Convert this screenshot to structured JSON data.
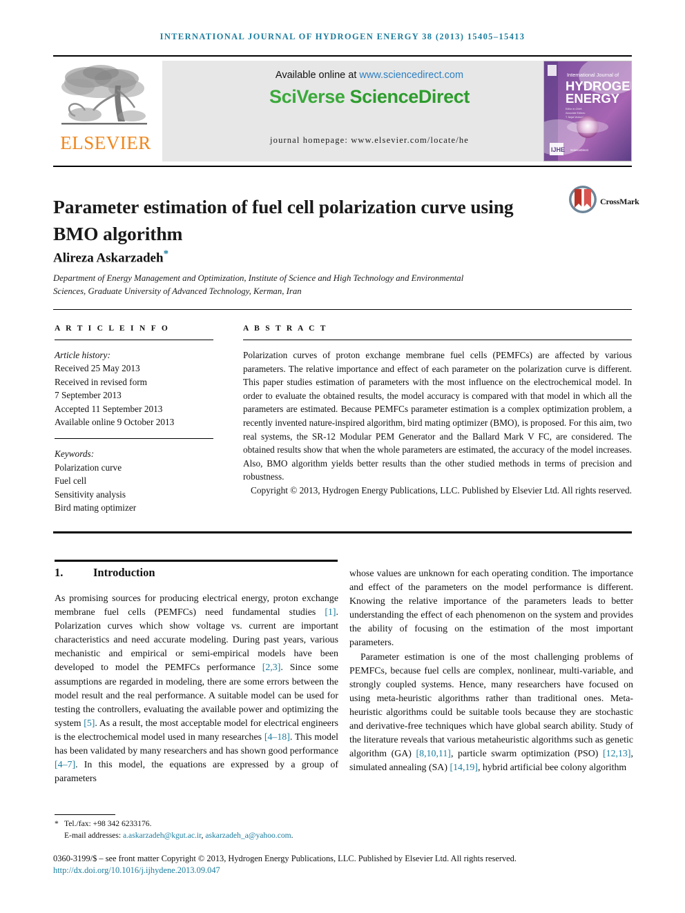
{
  "running_head": "International Journal of Hydrogen Energy 38 (2013) 15405–15413",
  "masthead": {
    "publisher_name": "ELSEVIER",
    "available_prefix": "Available online at ",
    "available_url": "www.sciencedirect.com",
    "platform_part1": "SciVerse ",
    "platform_part2": "ScienceDirect",
    "homepage": "journal homepage: www.elsevier.com/locate/he",
    "cover": {
      "line1": "International Journal of",
      "line2": "HYDROGEN",
      "line3": "ENERGY",
      "editor_label_1": "Editor-in-Chief:",
      "editor_label_2": "Associate Editors:",
      "footer_mark": "IJHE",
      "footer_text": "Available online at ScienceDirect"
    }
  },
  "article": {
    "title": "Parameter estimation of fuel cell polarization curve using BMO algorithm",
    "crossmark_label": "CrossMark",
    "author": "Alireza Askarzadeh",
    "author_marker": "*",
    "affiliation": "Department of Energy Management and Optimization, Institute of Science and High Technology and Environmental Sciences, Graduate University of Advanced Technology, Kerman, Iran"
  },
  "article_info": {
    "heading": "A R T I C L E  I N F O",
    "history_label": "Article history:",
    "history": [
      "Received 25 May 2013",
      "Received in revised form",
      "7 September 2013",
      "Accepted 11 September 2013",
      "Available online 9 October 2013"
    ],
    "keywords_label": "Keywords:",
    "keywords": [
      "Polarization curve",
      "Fuel cell",
      "Sensitivity analysis",
      "Bird mating optimizer"
    ]
  },
  "abstract": {
    "heading": "A B S T R A C T",
    "body": "Polarization curves of proton exchange membrane fuel cells (PEMFCs) are affected by various parameters. The relative importance and effect of each parameter on the polarization curve is different. This paper studies estimation of parameters with the most influence on the electrochemical model. In order to evaluate the obtained results, the model accuracy is compared with that model in which all the parameters are estimated. Because PEMFCs parameter estimation is a complex optimization problem, a recently invented nature-inspired algorithm, bird mating optimizer (BMO), is proposed. For this aim, two real systems, the SR-12 Modular PEM Generator and the Ballard Mark V FC, are considered. The obtained results show that when the whole parameters are estimated, the accuracy of the model increases. Also, BMO algorithm yields better results than the other studied methods in terms of precision and robustness.",
    "copyright": "Copyright © 2013, Hydrogen Energy Publications, LLC. Published by Elsevier Ltd. All rights reserved."
  },
  "introduction": {
    "number": "1.",
    "heading": "Introduction",
    "left_paragraph_parts": [
      "As promising sources for producing electrical energy, proton exchange membrane fuel cells (PEMFCs) need fundamental studies ",
      "[1]",
      ". Polarization curves which show voltage vs. current are important characteristics and need accurate modeling. During past years, various mechanistic and empirical or semi-empirical models have been developed to model the PEMFCs performance ",
      "[2,3]",
      ". Since some assumptions are regarded in modeling, there are some errors between the model result and the real performance. A suitable model can be used for testing the controllers, evaluating the available power and optimizing the system ",
      "[5]",
      ". As a result, the most acceptable model for electrical engineers is the electrochemical model used in many researches ",
      "[4–18]",
      ". This model has been validated by many researchers and has shown good performance ",
      "[4–7]",
      ". In this model, the equations are expressed by a group of parameters"
    ],
    "right_paragraph_1": "whose values are unknown for each operating condition. The importance and effect of the parameters on the model performance is different. Knowing the relative importance of the parameters leads to better understanding the effect of each phenomenon on the system and provides the ability of focusing on the estimation of the most important parameters.",
    "right_paragraph_2_parts": [
      "Parameter estimation is one of the most challenging problems of PEMFCs, because fuel cells are complex, nonlinear, multi-variable, and strongly coupled systems. Hence, many researchers have focused on using meta-heuristic algorithms rather than traditional ones. Meta-heuristic algorithms could be suitable tools because they are stochastic and derivative-free techniques which have global search ability. Study of the literature reveals that various metaheuristic algorithms such as genetic algorithm (GA) ",
      "[8,10,11]",
      ", particle swarm optimization (PSO) ",
      "[12,13]",
      ", simulated annealing (SA) ",
      "[14,19]",
      ", hybrid artificial bee colony algorithm"
    ]
  },
  "footer": {
    "tel_marker": "*",
    "tel": "Tel./fax: +98 342 6233176.",
    "email_label": "E-mail addresses: ",
    "email_1": "a.askarzadeh@kgut.ac.ir",
    "email_sep": ", ",
    "email_2": "askarzadeh_a@yahoo.com",
    "email_end": ".",
    "frontmatter": "0360-3199/$ – see front matter Copyright © 2013, Hydrogen Energy Publications, LLC. Published by Elsevier Ltd. All rights reserved.",
    "doi": "http://dx.doi.org/10.1016/j.ijhydene.2013.09.047"
  },
  "colors": {
    "link": "#1c7d9e",
    "sciencedirect_url": "#2b7fc1",
    "sciverse_green": "#3aa93a",
    "elsevier_orange": "#f0861b",
    "panel_gray": "#e7e7e7"
  }
}
